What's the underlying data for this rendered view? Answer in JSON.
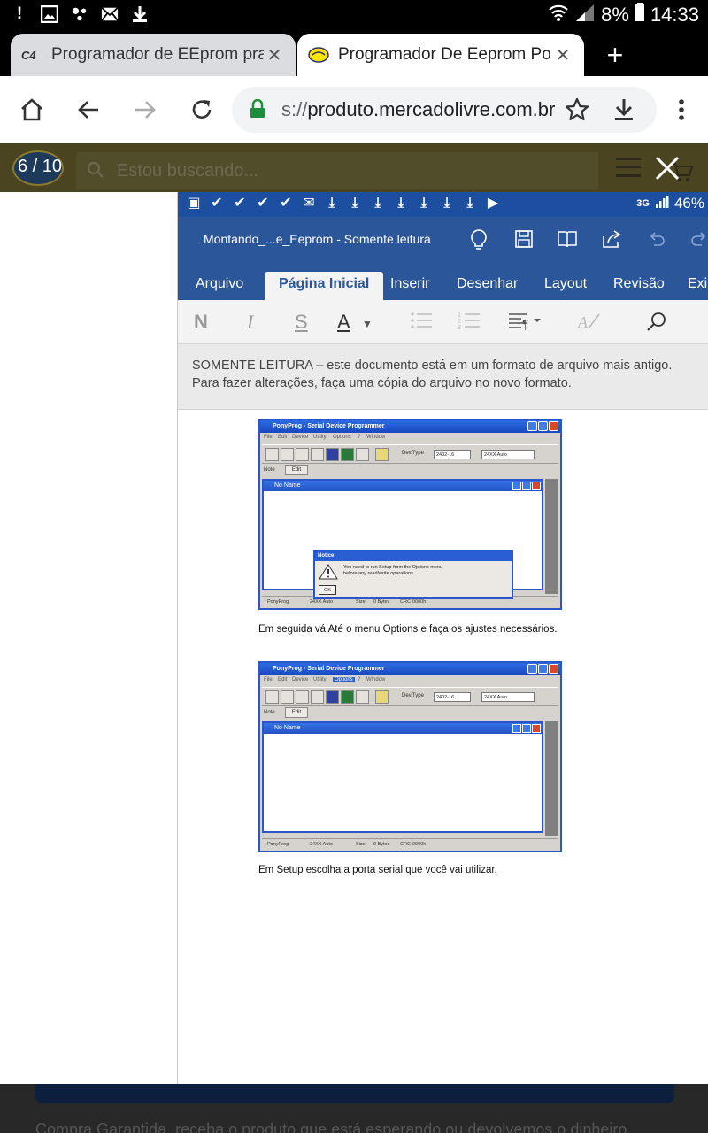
{
  "status_bar": {
    "battery": "8%",
    "time": "14:33"
  },
  "tabs": [
    {
      "title": "Programador de EEprom pra f",
      "favicon": "C4"
    },
    {
      "title": "Programador De Eeprom Port"
    }
  ],
  "omnibox": {
    "url_prefix": "s://",
    "url_host": "produto.mercadolivre.com.br"
  },
  "site": {
    "search_placeholder": "Estou buscando..."
  },
  "gallery": {
    "counter": "6 / 10"
  },
  "inner": {
    "status": {
      "network": "3G",
      "battery": "46%"
    },
    "word": {
      "doc_title": "Montando_...e_Eeprom - Somente leitura",
      "tabs": [
        "Arquivo",
        "Página Inicial",
        "Inserir",
        "Desenhar",
        "Layout",
        "Revisão",
        "Exib"
      ],
      "active_tab": "Página Inicial",
      "ribbon": {
        "bold": "N",
        "italic": "I",
        "strike": "S",
        "font_color": "A"
      },
      "readonly_line1": "SOMENTE LEITURA – este documento está em um formato de arquivo mais antigo.",
      "readonly_line2": "Para fazer alterações, faça uma cópia do arquivo no novo formato."
    },
    "ponyprog": {
      "title": "PonyProg - Serial Device Programmer",
      "menu": [
        "File",
        "Edit",
        "Device",
        "Utility",
        "Options",
        "?",
        "Window"
      ],
      "dev_type_label": "Dev.Type",
      "device": "2402-16",
      "family": "24XX Auto",
      "note_label": "Note",
      "edit_label": "Edit",
      "child_title": "No Name",
      "status": [
        "PonyProg",
        "24XX Auto",
        "Size",
        "0 Bytes",
        "CRC",
        "0000h"
      ],
      "notice": {
        "title": "Notice",
        "message_line1": "You need to run Setup from the Options menu",
        "message_line2": "before any read/write operations.",
        "ok": "OK"
      }
    },
    "caption1": "Em seguida vá Até o menu Options e faça os ajustes necessários.",
    "caption2": "Em Setup escolha a porta serial que você vai utilizar."
  },
  "page_footer": "Compra Garantida, receba o produto que está esperando ou devolvemos o dinheiro",
  "colors": {
    "word_blue": "#2b579a",
    "chrome_bg": "#000000",
    "accent_green": "#1e8e3e"
  }
}
